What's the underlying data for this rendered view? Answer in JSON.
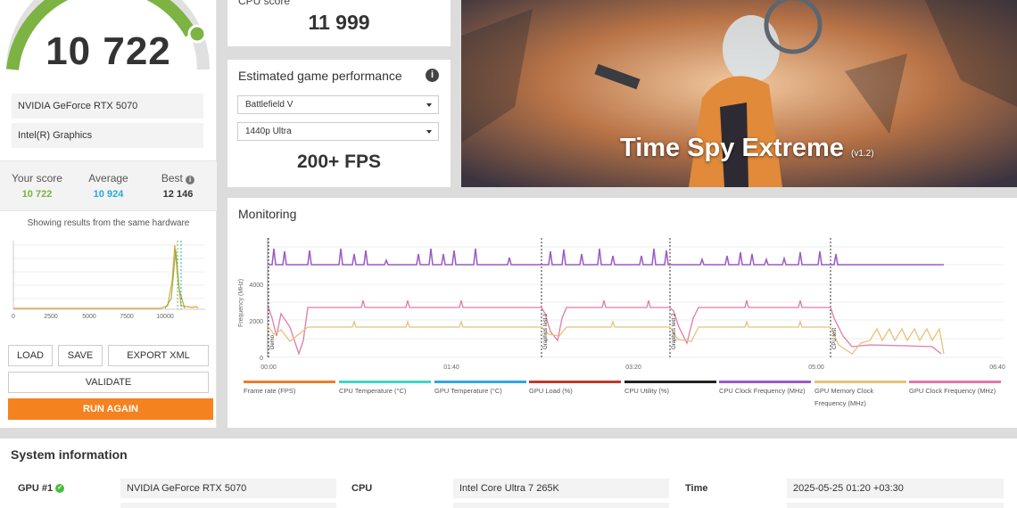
{
  "score": {
    "total": "10 722",
    "gauge_fraction": 0.88,
    "hardware": [
      "NVIDIA GeForce RTX 5070",
      "Intel(R) Graphics"
    ],
    "your_score_label": "Your score",
    "your_score_value": "10 722",
    "average_label": "Average",
    "average_value": "10 924",
    "best_label": "Best",
    "best_value": "12 146",
    "distribution_caption": "Showing results from the same hardware",
    "distribution_ticks": [
      "0",
      "2500",
      "5000",
      "7500",
      "10000"
    ],
    "buttons": {
      "load": "LOAD",
      "save": "SAVE",
      "export": "EXPORT XML",
      "validate": "VALIDATE",
      "run_again": "RUN AGAIN"
    },
    "colors": {
      "your_score": "#7cb342",
      "average": "#29a8d8",
      "accent": "#f5821f"
    }
  },
  "cpu": {
    "label": "CPU score",
    "value": "11 999"
  },
  "game": {
    "title": "Estimated game performance",
    "game_select": "Battlefield V",
    "resolution_select": "1440p Ultra",
    "fps": "200+ FPS"
  },
  "hero": {
    "title": "Time Spy Extreme",
    "version": "(v1.2)"
  },
  "monitoring": {
    "title": "Monitoring",
    "y_label": "Frequency (MHz)",
    "y_ticks": [
      "4000",
      "2000",
      "0"
    ],
    "x_ticks": [
      "00:00",
      "01:40",
      "03:20",
      "05:00",
      "06:40"
    ],
    "phase_markers": [
      "Demo",
      "Graphics test 1",
      "Graphics test 2",
      "CPU test"
    ],
    "legend": [
      {
        "label": "Frame rate (FPS)",
        "color": "#e97e2d"
      },
      {
        "label": "CPU Temperature (°C)",
        "color": "#3fd6c6"
      },
      {
        "label": "GPU Temperature (°C)",
        "color": "#2ea8e0"
      },
      {
        "label": "GPU Load (%)",
        "color": "#c0392b"
      },
      {
        "label": "CPU Utility (%)",
        "color": "#222222"
      },
      {
        "label": "CPU Clock Frequency (MHz)",
        "color": "#9b59c6"
      },
      {
        "label": "GPU Memory Clock Frequency (MHz)",
        "color": "#e6c27a"
      },
      {
        "label": "GPU Clock Frequency (MHz)",
        "color": "#e07aa8"
      }
    ]
  },
  "system": {
    "title": "System information",
    "gpu_key": "GPU #1",
    "gpu_value": "NVIDIA GeForce RTX 5070",
    "cpu_key": "CPU",
    "cpu_value": "Intel Core Ultra 7 265K",
    "time_key": "Time",
    "time_value": "2025-05-25 01:20 +03:30"
  }
}
